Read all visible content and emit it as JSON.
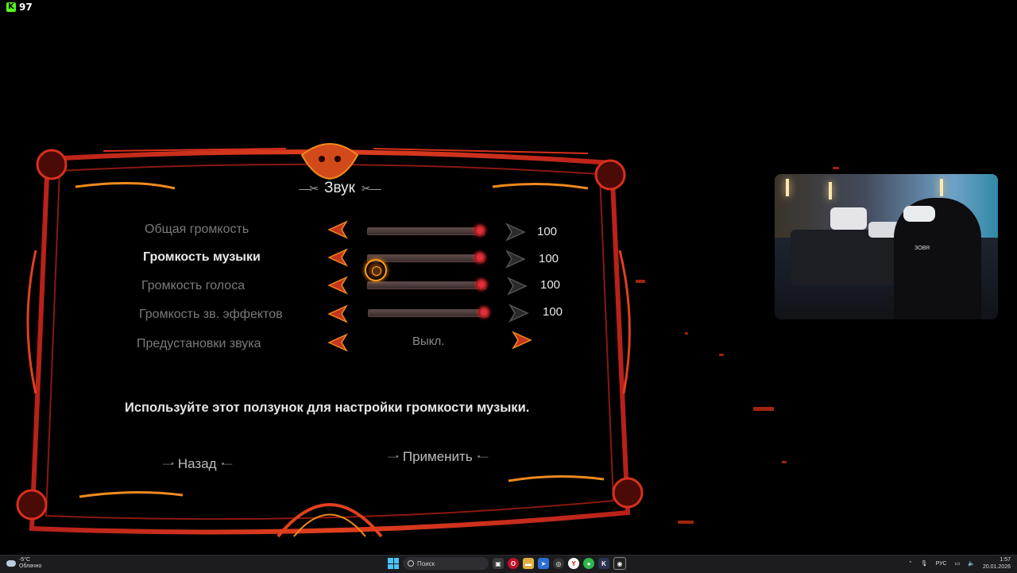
{
  "overlay": {
    "kick_count": "97"
  },
  "menu": {
    "title": "Звук",
    "rows": [
      {
        "label": "Общая громкость",
        "value": "100",
        "level": 1.0
      },
      {
        "label": "Громкость музыки",
        "value": "100",
        "level": 1.0,
        "active": true
      },
      {
        "label": "Громкость голоса",
        "value": "100",
        "level": 1.0
      },
      {
        "label": "Громкость зв. эффектов",
        "value": "100",
        "level": 1.0
      },
      {
        "label": "Предустановки звука",
        "value": "Выкл."
      }
    ],
    "hint": "Используйте этот ползунок для настройки громкости музыки.",
    "back_label": "Назад",
    "apply_label": "Применить"
  },
  "webcam": {
    "name_tag": "ЗОВЯ"
  },
  "taskbar": {
    "weather_temp": "-5°C",
    "weather_desc": "Облачно",
    "search_placeholder": "Поиск",
    "language": "РУС",
    "time": "1:57",
    "date": "20.01.2026"
  },
  "colors": {
    "frame_red": "#c8281c",
    "frame_orange": "#f08a1e",
    "accent_slider": "#e0303a"
  }
}
